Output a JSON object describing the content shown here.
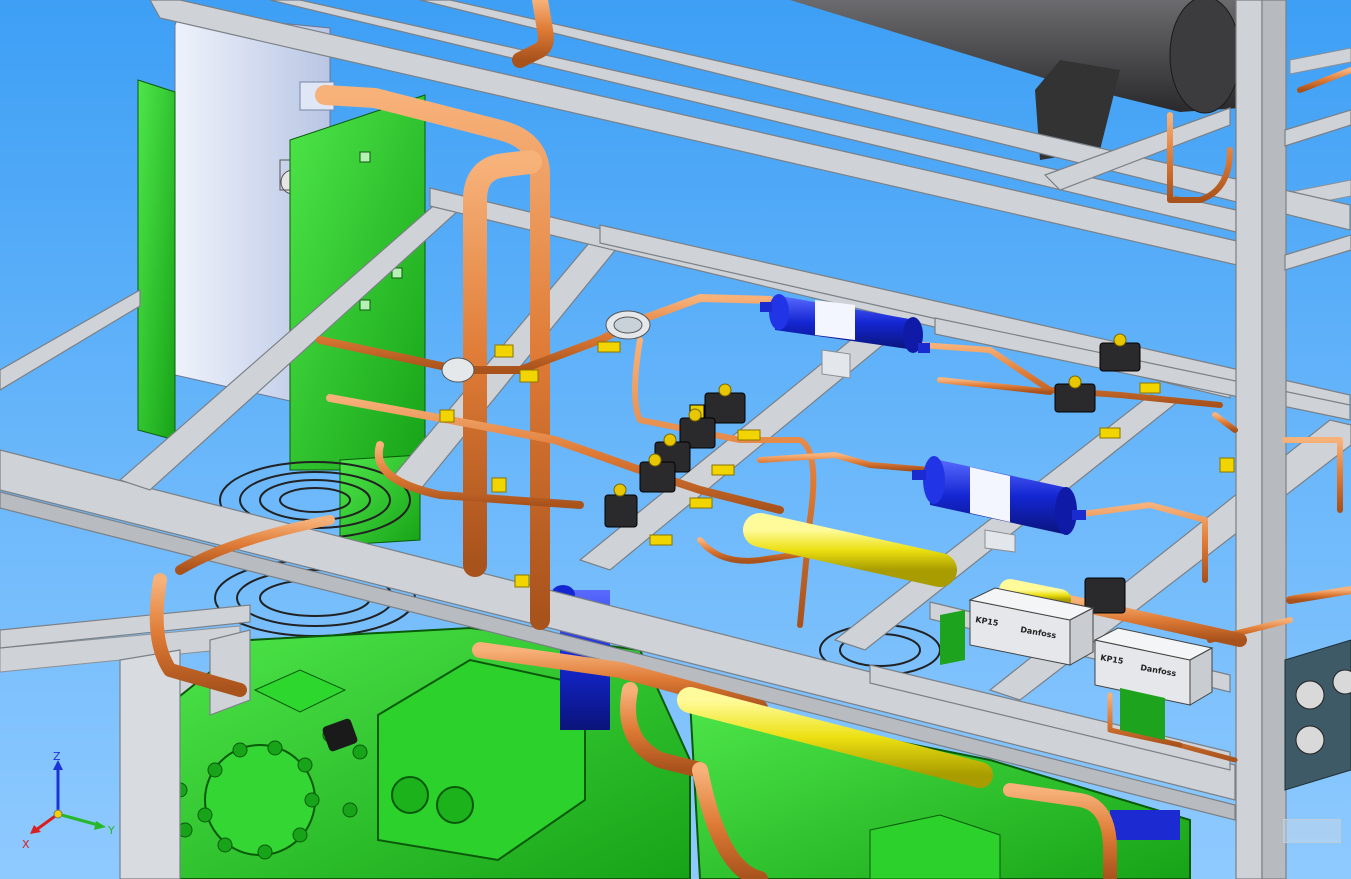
{
  "model": {
    "pressure_switches": [
      {
        "model": "KP15",
        "brand": "Danfoss"
      },
      {
        "model": "KP15",
        "brand": "Danfoss"
      }
    ]
  },
  "triad": {
    "x": "X",
    "y": "Y",
    "z": "Z"
  },
  "colors": {
    "background": "#5ab0fa",
    "frame": "#cfd3d8",
    "copper": "#e07e3c",
    "compressor": "#22c322",
    "filter_drier": "#1a2fd6",
    "receiver": "#3a3a3c",
    "insulation": "#f2ea10"
  }
}
